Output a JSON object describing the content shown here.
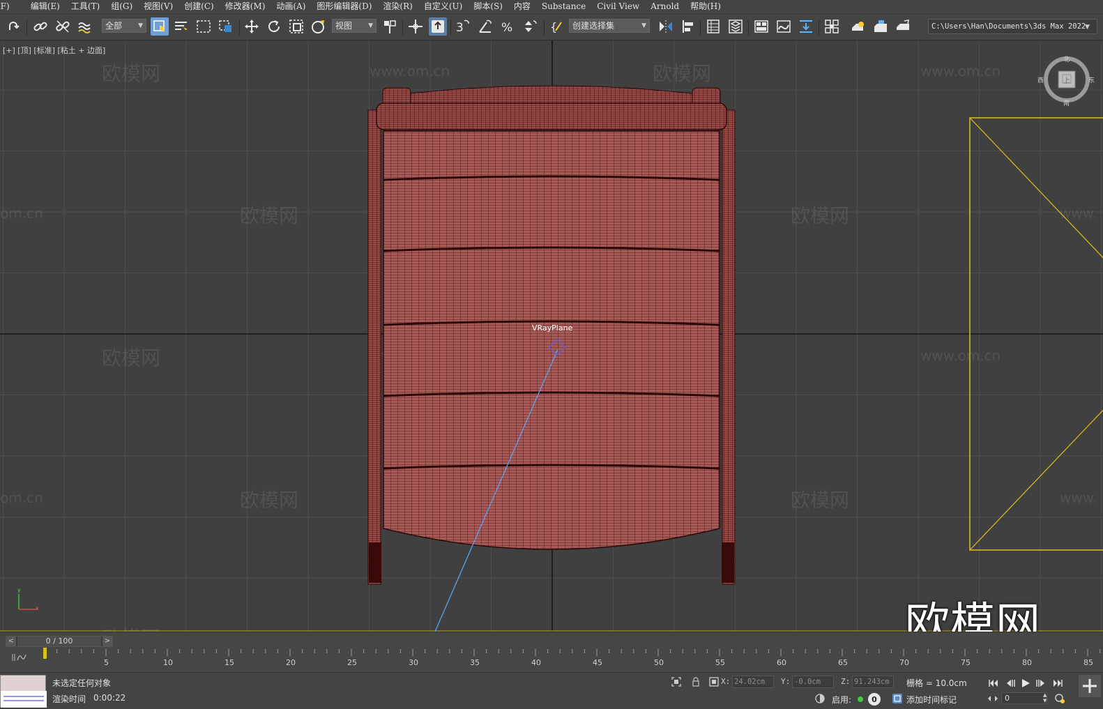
{
  "menu": [
    {
      "label": "(F)"
    },
    {
      "label": "编辑(E)"
    },
    {
      "label": "工具(T)"
    },
    {
      "label": "组(G)"
    },
    {
      "label": "视图(V)"
    },
    {
      "label": "创建(C)"
    },
    {
      "label": "修改器(M)"
    },
    {
      "label": "动画(A)"
    },
    {
      "label": "图形编辑器(D)"
    },
    {
      "label": "渲染(R)"
    },
    {
      "label": "自定义(U)"
    },
    {
      "label": "脚本(S)"
    },
    {
      "label": "内容"
    },
    {
      "label": "Substance"
    },
    {
      "label": "Civil View"
    },
    {
      "label": "Arnold"
    },
    {
      "label": "帮助(H)"
    }
  ],
  "toolbar": {
    "selection_filter": "全部",
    "reference_coord": "视图",
    "named_selection": "创建选择集",
    "project_path": "C:\\Users\\Han\\Documents\\3ds Max 2022"
  },
  "viewport": {
    "label": "[+] [顶] [标准] [粘土 + 边面]",
    "object_label": "VRayPlane",
    "watermark_text": "欧模网",
    "watermark_url": "www.om.cn",
    "watermark_url_short": "om.cn",
    "watermark_url_cut": "www.",
    "viewcube": {
      "top_face": "上",
      "north": "北",
      "south": "南",
      "east": "东",
      "west": "西"
    },
    "axis_y": "y",
    "axis_x": "x"
  },
  "timeline": {
    "frame_display": "0 / 100",
    "prev_label": "<",
    "next_label": ">",
    "ticks": [
      "5",
      "10",
      "15",
      "20",
      "25",
      "30",
      "35",
      "40",
      "45",
      "50",
      "55",
      "60",
      "65",
      "70",
      "75",
      "80",
      "85"
    ]
  },
  "status": {
    "message": "未选定任何对象",
    "render_time_label": "渲染时间",
    "render_time": "0:00:22",
    "x_label": "X:",
    "x_value": "24.02cm",
    "y_label": "Y:",
    "y_value": "-0.0cm",
    "z_label": "Z:",
    "z_value": "91.243cm",
    "grid": "栅格 = 10.0cm",
    "enable_label": "启用:",
    "enable_count": "0",
    "add_time_tag": "添加时间标记",
    "current_frame": "0"
  },
  "colors": {
    "model_fill": "#a0524e",
    "model_wire": "#3a0c0c",
    "accent": "#6e9fd6",
    "light_selection": "#d9c01a",
    "light_dir": "#5aa8ff",
    "grid_major": "#000000",
    "grid_minor": "#4e4e4e"
  }
}
